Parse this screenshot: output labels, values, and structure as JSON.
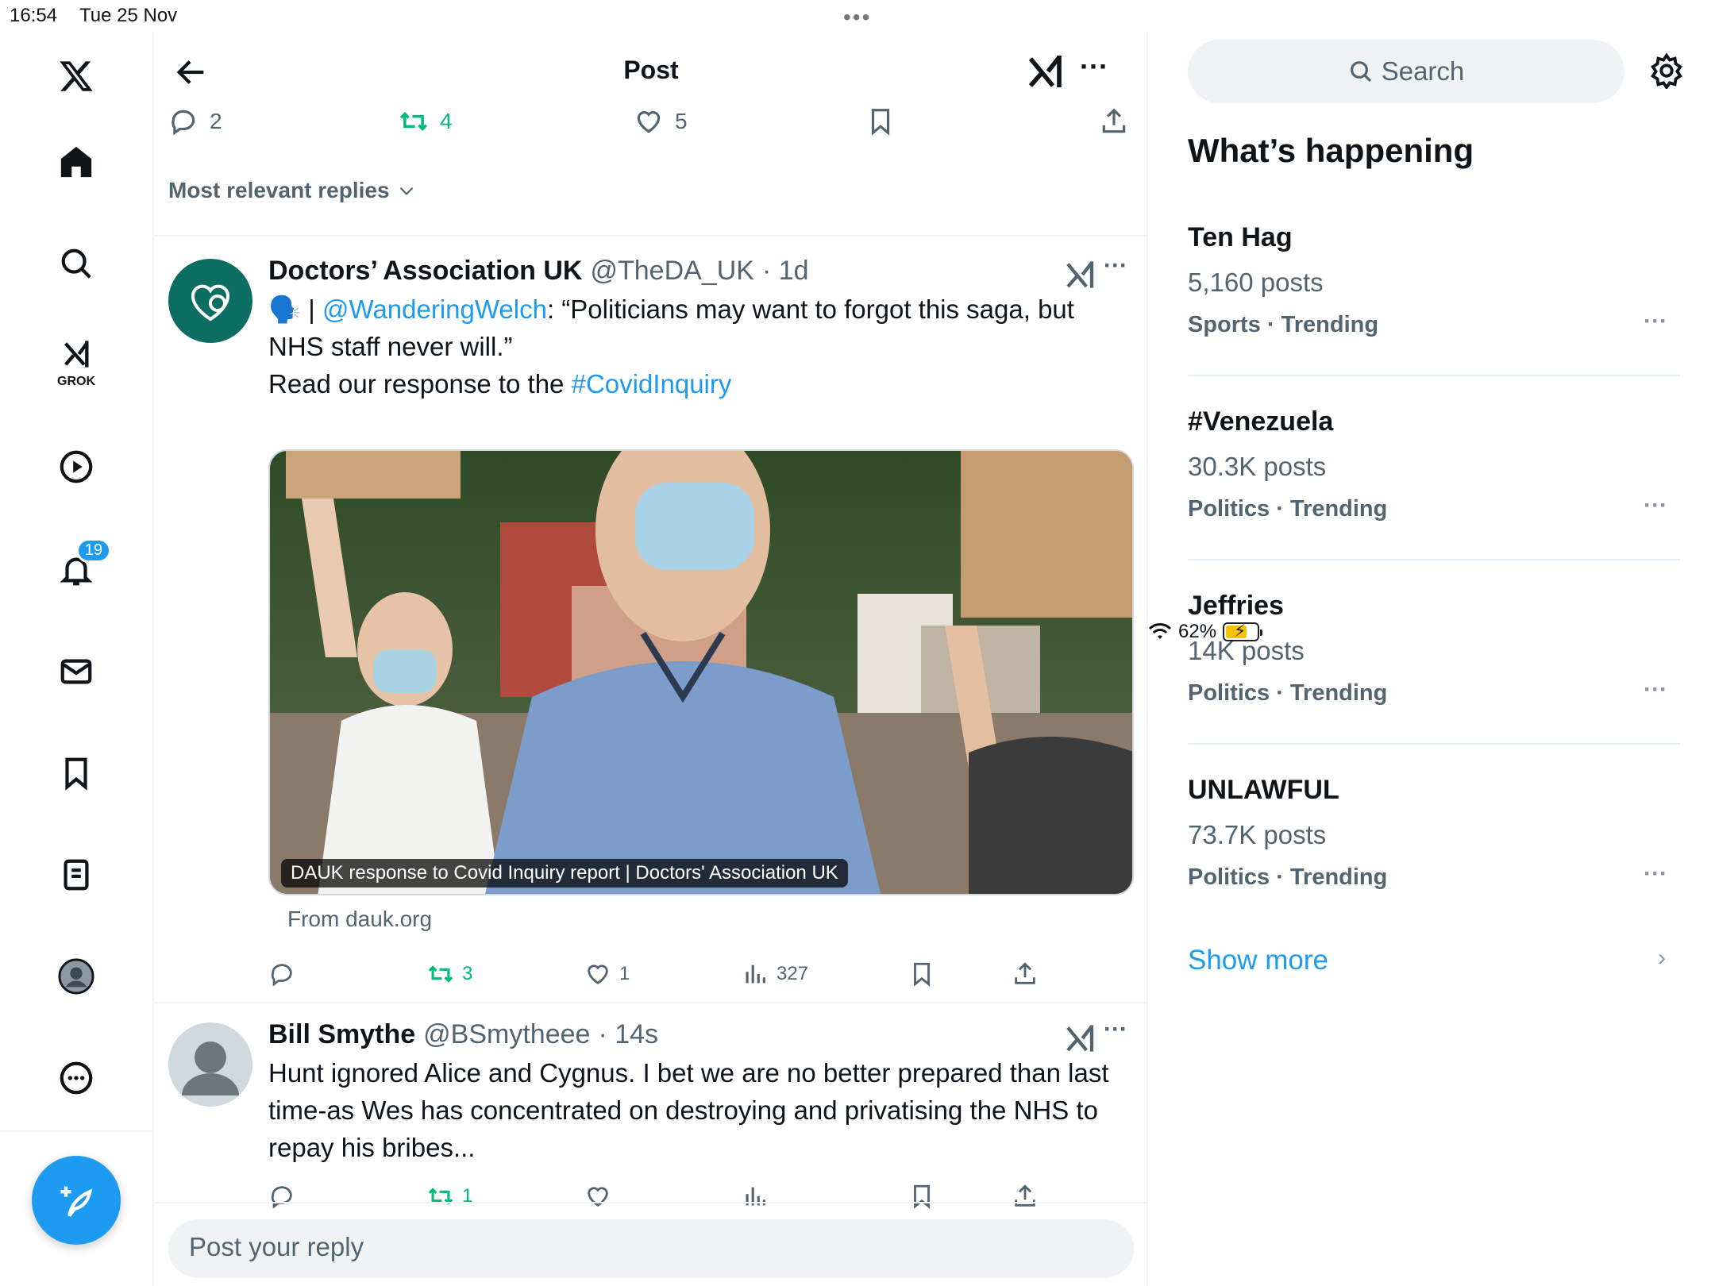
{
  "status_bar": {
    "time": "16:54",
    "date": "Tue 25 Nov",
    "battery_pct": "62%",
    "battery_level": 0.62
  },
  "nav": {
    "notifications_badge": "19",
    "grok_label": "GROK"
  },
  "header": {
    "title": "Post"
  },
  "top_actions": {
    "replies": "2",
    "reposts": "4",
    "likes": "5"
  },
  "sort_label": "Most relevant replies",
  "tweets": [
    {
      "name": "Doctors’ Association UK",
      "handle": "@TheDA_UK",
      "time": "· 1d",
      "emoji": "🗣️",
      "body_part1_sep": " | ",
      "mention": "@WanderingWelch",
      "body_part2": ": “Politicians may want to forgot this saga, but NHS staff never will.”",
      "body_part3": "Read our response to the ",
      "hashtag": "#CovidInquiry",
      "media_caption": "DAUK response to Covid Inquiry report | Doctors' Association UK",
      "from": "From dauk.org",
      "replies": "",
      "reposts": "3",
      "likes": "1",
      "views": "327"
    },
    {
      "name": "Bill Smythe",
      "handle": "@BSmytheee",
      "time": "· 14s",
      "body": "Hunt ignored Alice and Cygnus. I bet we are no better prepared than last time-as Wes has concentrated on destroying and privatising the NHS to repay his bribes...",
      "reposts": "1"
    }
  ],
  "reply_placeholder": "Post your reply",
  "sidebar": {
    "search_placeholder": "Search",
    "heading": "What’s happening",
    "trends": [
      {
        "name": "Ten Hag",
        "count": "5,160 posts",
        "category": "Sports · Trending"
      },
      {
        "name": "#Venezuela",
        "count": "30.3K posts",
        "category": "Politics · Trending"
      },
      {
        "name": "Jeffries",
        "count": "14K posts",
        "category": "Politics · Trending"
      },
      {
        "name": "UNLAWFUL",
        "count": "73.7K posts",
        "category": "Politics · Trending"
      }
    ],
    "show_more": "Show more"
  },
  "colors": {
    "accent": "#1d9bf0",
    "repost_green": "#00ba7c",
    "secondary_text": "#536471",
    "dauk_teal": "#0c6d63"
  }
}
